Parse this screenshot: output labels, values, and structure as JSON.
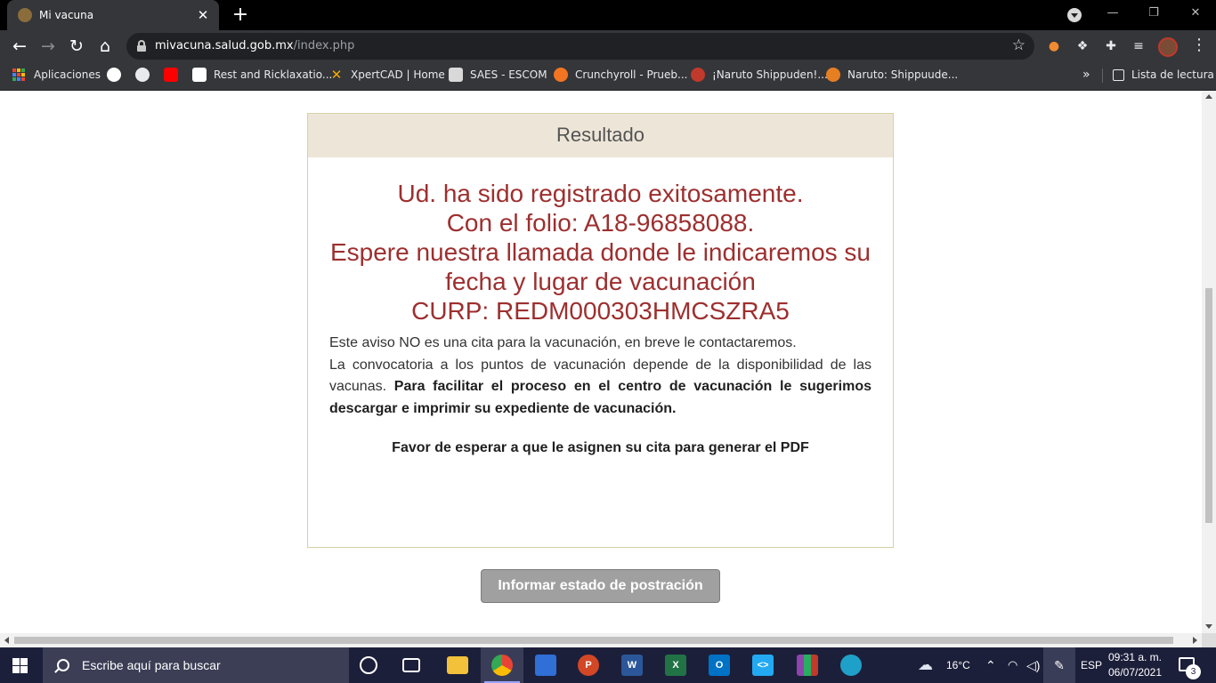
{
  "browser": {
    "tab_title": "Mi vacuna",
    "tab_close": "✕",
    "new_tab": "+",
    "url_host": "mivacuna.salud.gob.mx",
    "url_path": "/index.php",
    "bookmarks": [
      {
        "label": "Aplicaciones",
        "icon": "apps-grid-icon"
      },
      {
        "label": "",
        "icon": "google-icon"
      },
      {
        "label": "",
        "icon": "globe-icon"
      },
      {
        "label": "",
        "icon": "youtube-icon"
      },
      {
        "label": "Rest and Ricklaxatio...",
        "icon": "as-icon"
      },
      {
        "label": "XpertCAD | Home",
        "icon": "xpertcad-icon"
      },
      {
        "label": "SAES - ESCOM",
        "icon": "saes-icon"
      },
      {
        "label": "Crunchyroll - Prueb...",
        "icon": "crunchyroll-icon"
      },
      {
        "label": "¡Naruto Shippuden!...",
        "icon": "naruto-icon"
      },
      {
        "label": "Naruto: Shippuude...",
        "icon": "n-icon"
      }
    ],
    "bookmarks_more": "»",
    "reading_list": "Lista de lectura"
  },
  "colors": {
    "panel_header_bg": "#ede6d8",
    "success_text": "#9d2f2f",
    "button_bg": "#a0a0a0",
    "taskbar_bg": "#1c1f3a"
  },
  "result": {
    "header": "Resultado",
    "success_lines": [
      "Ud. ha sido registrado exitosamente.",
      "Con el folio: A18-96858088.",
      "Espere nuestra llamada donde le indicaremos su fecha y lugar de vacunación",
      "CURP: REDM000303HMCSZRA5"
    ],
    "notice_line1": "Este aviso NO es una cita para la vacunación, en breve le contactaremos.",
    "notice_line2": "La convocatoria a los puntos de vacunación depende de la disponibilidad de las vacunas.",
    "notice_bold": "Para facilitar el proceso en el centro de vacunación le sugerimos descargar e imprimir su expediente de vacunación.",
    "wait_text": "Favor de esperar a que le asignen su cita para generar el PDF"
  },
  "report_button": "Informar estado de postración",
  "taskbar": {
    "search_placeholder": "Escribe aquí para buscar",
    "temperature": "16°C",
    "language": "ESP",
    "time": "09:31 a. m.",
    "date": "06/07/2021",
    "notification_count": "3",
    "apps": [
      "cortana-icon",
      "task-view-icon",
      "file-explorer-icon",
      "chrome-icon",
      "store-icon",
      "powerpoint-icon",
      "word-icon",
      "excel-icon",
      "outlook-icon",
      "vscode-icon",
      "winrar-icon",
      "edge-icon"
    ]
  }
}
